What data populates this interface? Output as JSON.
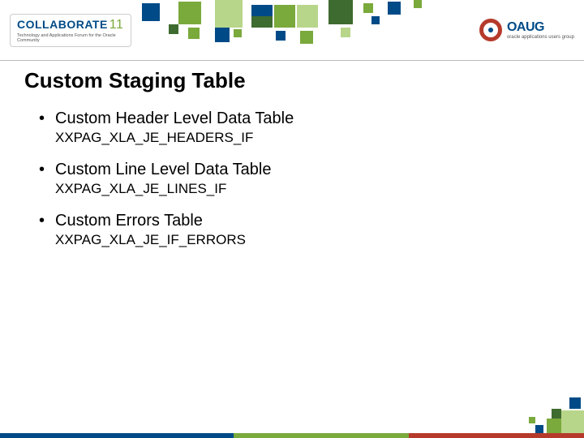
{
  "branding": {
    "left_logo_main": "COLLABORATE",
    "left_logo_year": "11",
    "left_logo_tagline": "Technology and Applications Forum for the Oracle Community",
    "right_logo_brand": "OAUG",
    "right_logo_sub": "oracle applications users group"
  },
  "slide": {
    "title": "Custom Staging Table",
    "bullets": [
      {
        "label": "Custom Header Level Data Table",
        "sub": "XXPAG_XLA_JE_HEADERS_IF"
      },
      {
        "label": "Custom Line Level Data Table",
        "sub": "XXPAG_XLA_JE_LINES_IF"
      },
      {
        "label": "Custom Errors Table",
        "sub": "XXPAG_XLA_JE_IF_ERRORS"
      }
    ]
  },
  "palette": {
    "navy": "#004b87",
    "green_dark": "#3e6b2f",
    "green_mid": "#7aa93c",
    "green_light": "#b8d68a",
    "red": "#b63a2b"
  }
}
